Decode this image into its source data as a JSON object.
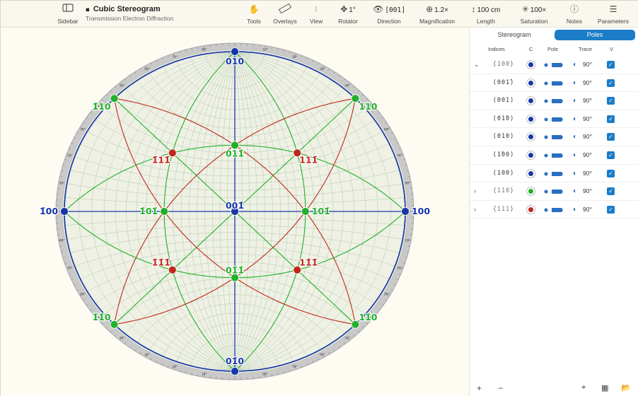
{
  "toolbar": {
    "sidebar_label": "Sidebar",
    "title": "Cubic Stereogram",
    "subtitle": "Transmission Electron Diffraction",
    "tools_label": "Tools",
    "overlays_label": "Overlays",
    "view_label": "View",
    "rotator_label": "Rotator",
    "rotator_value": "1°",
    "direction_label": "Direction",
    "direction_value": "[001]",
    "magnification_label": "Magnification",
    "magnification_value": "1.2×",
    "length_label": "Length",
    "length_value": "100 cm",
    "saturation_label": "Saturation",
    "saturation_value": "100×",
    "notes_label": "Notes",
    "parameters_label": "Parameters"
  },
  "panel": {
    "tabs": [
      {
        "label": "Stereogram",
        "selected": false
      },
      {
        "label": "Poles",
        "selected": true
      }
    ],
    "columns": {
      "indices": "Indices",
      "color": "C",
      "pole": "Pole",
      "trace": "Trace",
      "visible": "V"
    },
    "rows": [
      {
        "indices": "{100}",
        "color": "#1736a8",
        "angle": "90°",
        "expanded": true,
        "family": true
      },
      {
        "indices": "(001̄)",
        "color": "#1736a8",
        "angle": "90°",
        "expanded": false,
        "family": false
      },
      {
        "indices": "(001)",
        "color": "#1736a8",
        "angle": "90°",
        "expanded": false,
        "family": false
      },
      {
        "indices": "(01̄0)",
        "color": "#1736a8",
        "angle": "90°",
        "expanded": false,
        "family": false
      },
      {
        "indices": "(010)",
        "color": "#1736a8",
        "angle": "90°",
        "expanded": false,
        "family": false
      },
      {
        "indices": "(1̄00)",
        "color": "#1736a8",
        "angle": "90°",
        "expanded": false,
        "family": false
      },
      {
        "indices": "(100)",
        "color": "#1736a8",
        "angle": "90°",
        "expanded": false,
        "family": false
      },
      {
        "indices": "{110}",
        "color": "#22b02a",
        "angle": "90°",
        "expanded": false,
        "family": true
      },
      {
        "indices": "{111}",
        "color": "#c0281c",
        "angle": "90°",
        "expanded": false,
        "family": true
      }
    ],
    "add_label": "+",
    "remove_label": "−"
  },
  "colors": {
    "blue": "#1736a8",
    "green": "#22b02a",
    "red": "#c0281c",
    "accent": "#1b7cc7"
  },
  "stereogram": {
    "poles": [
      {
        "label": "001̄",
        "family": "100",
        "color": "blue"
      },
      {
        "label": "01̄0",
        "family": "100",
        "color": "blue"
      },
      {
        "label": "010",
        "family": "100",
        "color": "blue"
      },
      {
        "label": "1̄00",
        "family": "100",
        "color": "blue"
      },
      {
        "label": "100",
        "family": "100",
        "color": "blue"
      },
      {
        "label": "01̄1̄",
        "family": "110",
        "color": "green"
      },
      {
        "label": "011̄",
        "family": "110",
        "color": "green"
      },
      {
        "label": "1̄01̄",
        "family": "110",
        "color": "green"
      },
      {
        "label": "101̄",
        "family": "110",
        "color": "green"
      },
      {
        "label": "1̄1̄0",
        "family": "110",
        "color": "green"
      },
      {
        "label": "11̄0",
        "family": "110",
        "color": "green"
      },
      {
        "label": "1̄10",
        "family": "110",
        "color": "green"
      },
      {
        "label": "110",
        "family": "110",
        "color": "green"
      },
      {
        "label": "1̄1̄1̄",
        "family": "111",
        "color": "red"
      },
      {
        "label": "11̄1̄",
        "family": "111",
        "color": "red"
      },
      {
        "label": "1̄11̄",
        "family": "111",
        "color": "red"
      },
      {
        "label": "111̄",
        "family": "111",
        "color": "red"
      }
    ],
    "ring_ticks": [
      "10°",
      "20°",
      "30°",
      "40°",
      "50°",
      "60°",
      "70°",
      "80°"
    ]
  }
}
